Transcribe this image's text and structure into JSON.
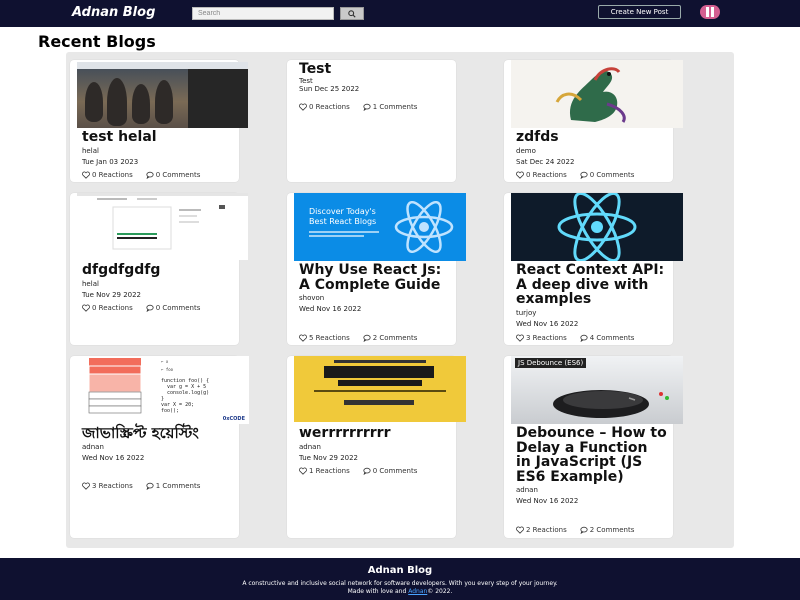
{
  "navbar": {
    "brand": "Adnan Blog",
    "search_placeholder": "Search",
    "create_post_label": "Create New Post"
  },
  "page": {
    "title": "Recent Blogs"
  },
  "cards": [
    {
      "title": "test helal",
      "author": "helal",
      "date": "Tue Jan 03 2023",
      "reactions": "0 Reactions",
      "comments": "0 Comments",
      "thumb": "photo"
    },
    {
      "title": "Test",
      "author": "Test",
      "date": "Sun Dec 25 2022",
      "reactions": "0 Reactions",
      "comments": "1 Comments",
      "thumb": "none"
    },
    {
      "title": "zdfds",
      "author": "demo",
      "date": "Sat Dec 24 2022",
      "reactions": "0 Reactions",
      "comments": "0 Comments",
      "thumb": "dragon"
    },
    {
      "title": "dfgdfgdfg",
      "author": "helal",
      "date": "Tue Nov 29 2022",
      "reactions": "0 Reactions",
      "comments": "0 Comments",
      "thumb": "screen"
    },
    {
      "title": "Why Use React Js: A Complete Guide",
      "author": "shovon",
      "date": "Wed Nov 16 2022",
      "reactions": "5 Reactions",
      "comments": "2 Comments",
      "thumb": "react-blue",
      "thumb_text": "Discover Today's Best React Blogs"
    },
    {
      "title": "React Context API: A deep dive with examples",
      "author": "turjoy",
      "date": "Wed Nov 16 2022",
      "reactions": "3 Reactions",
      "comments": "4 Comments",
      "thumb": "react-dark"
    },
    {
      "title": "জাভাস্ক্রিপ্ট হয়েস্টিং",
      "author": "adnan",
      "date": "Wed Nov 16 2022",
      "reactions": "3 Reactions",
      "comments": "1 Comments",
      "thumb": "diagram",
      "thumb_brand": "0xCODE"
    },
    {
      "title": "werrrrrrrrrr",
      "author": "adnan",
      "date": "Tue Nov 29 2022",
      "reactions": "1 Reactions",
      "comments": "0 Comments",
      "thumb": "yellow"
    },
    {
      "title": "Debounce – How to Delay a Function in JavaScript (JS ES6 Example)",
      "author": "adnan",
      "date": "Wed Nov 16 2022",
      "reactions": "2 Reactions",
      "comments": "2 Comments",
      "thumb": "mouse",
      "thumb_text": "JS Debounce (ES6)"
    }
  ],
  "footer": {
    "title": "Adnan Blog",
    "tagline": "A constructive and inclusive social network for software developers. With you every step of your journey.",
    "credit_prefix": "Made with love and ",
    "credit_link": "Adnan",
    "credit_suffix": "© 2022."
  },
  "colors": {
    "navbar": "#0f1130",
    "panel": "#e8e8e8",
    "link": "#4aa3ff"
  }
}
